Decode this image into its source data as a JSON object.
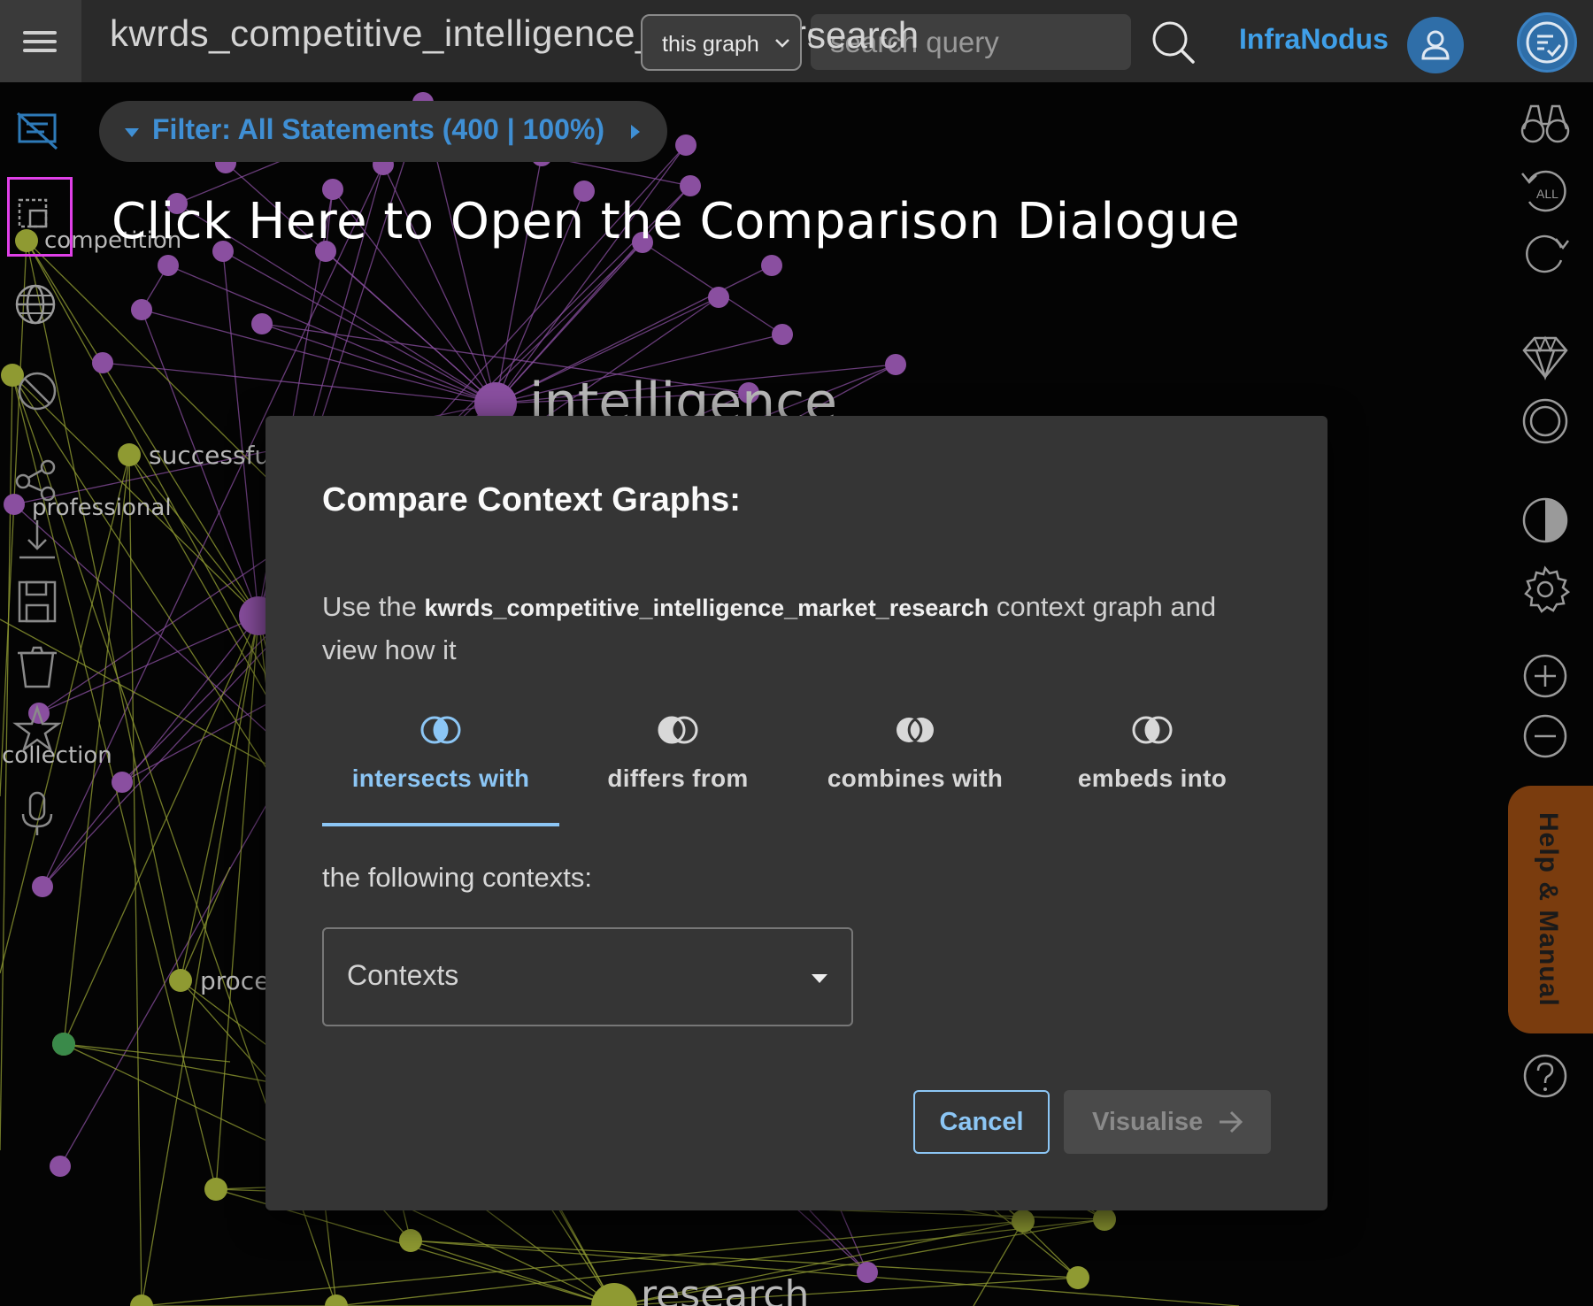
{
  "header": {
    "menu_icon": "hamburger-menu-icon",
    "graph_name": "kwrds_competitive_intelligence_market_research",
    "scope_select": {
      "value": "this graph"
    },
    "search": {
      "placeholder": "search query",
      "overlay_word": "search"
    },
    "search_icon": "magnifier-icon",
    "brand": "InfraNodus",
    "user_icon": "user-icon",
    "status_icon": "document-check-icon"
  },
  "filter": {
    "label": "Filter: All Statements (400 | 100%)"
  },
  "hint": "Click Here to Open the Comparison Dialogue",
  "graph": {
    "colors": {
      "purple": "#8a4fa0",
      "green": "#8f9a32",
      "teal": "#3a8a4a",
      "label": "#b8b8b8"
    },
    "labels": {
      "intelligence": "intelligence",
      "research": "research",
      "competition": "competition",
      "successful": "successful",
      "professional": "professional",
      "collection": "collection",
      "process": "proce"
    }
  },
  "left_toolbar": [
    "hide-statements-icon",
    "compare-icon",
    "globe-icon",
    "ban-icon",
    "share-icon",
    "download-icon",
    "save-icon",
    "trash-icon",
    "star-icon",
    "microphone-icon"
  ],
  "right_toolbar": [
    "binoculars-icon",
    "reset-all-icon",
    "refresh-icon",
    "diamond-icon",
    "circle-icon",
    "contrast-icon",
    "settings-icon",
    "zoom-in-icon",
    "zoom-out-icon",
    "help-icon"
  ],
  "help_tab": "Help & Manual",
  "modal": {
    "title": "Compare Context Graphs:",
    "desc_prefix": "Use the",
    "desc_graph": "kwrds_competitive_intelligence_market_research",
    "desc_suffix": "context graph and view how it",
    "tabs": [
      {
        "label": "intersects with",
        "icon": "intersect-icon"
      },
      {
        "label": "differs from",
        "icon": "difference-icon"
      },
      {
        "label": "combines with",
        "icon": "union-icon"
      },
      {
        "label": "embeds into",
        "icon": "embed-icon"
      }
    ],
    "active_tab": 0,
    "following_label": "the following contexts:",
    "contexts_select": {
      "value": "Contexts"
    },
    "cancel_label": "Cancel",
    "visualise_label": "Visualise",
    "accent": "#8cc6f5"
  }
}
